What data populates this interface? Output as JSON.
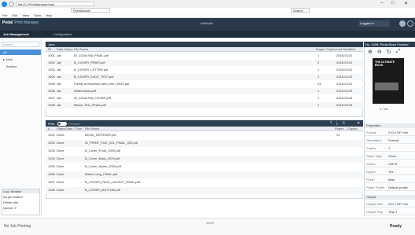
{
  "window": {
    "title": "Ready - FileManager",
    "min_glyph": "–",
    "max_glyph": "□",
    "close_glyph": "✕"
  },
  "browser": {
    "address": "file://C:/PrintManager/jobs",
    "tab_label": "FileManager",
    "menu_items": [
      "File",
      "Edit",
      "View",
      "Tools",
      "Help"
    ],
    "right_field": "Search"
  },
  "app": {
    "brand_a": "Pedal",
    "brand_b": "Print Manager",
    "center_label": "Hotfolder",
    "user_label": "Logged in",
    "nav_tabs": [
      "Job Management",
      "Configuration"
    ]
  },
  "sidebar": {
    "search_placeholder": "Search",
    "items": [
      {
        "label": "All",
        "selected": true
      },
      {
        "label": "Jobs"
      },
      {
        "label": "Archive"
      }
    ],
    "bottom_title": "Log / Monitor",
    "bottom_lines": [
      "No job loaded",
      "Printer idle",
      "Queue: 0"
    ]
  },
  "upper_panel": {
    "title": "Jobs",
    "columns": [
      "ID",
      "Date",
      "Name",
      "File Name",
      "Pages",
      "Copies",
      "Last Modified"
    ],
    "rows": [
      {
        "id": "1001",
        "date": "Jan",
        "file": "ID_1024x768_FINAL.pdf",
        "pages": "1",
        "mod": "2018-03-01"
      },
      {
        "id": "1002",
        "date": "Jan",
        "file": "B_COVER_PRINT.pdf",
        "pages": "2",
        "mod": "2018-03-01"
      },
      {
        "id": "1003",
        "date": "Jan",
        "file": "B_COVER_LETTER.pdf",
        "pages": "1",
        "mod": "2018-03-02"
      },
      {
        "id": "1004",
        "date": "Jan",
        "file": "B_COVER_FACE_TEXT.pdf",
        "pages": "1",
        "mod": "2018-03-02"
      },
      {
        "id": "1005",
        "date": "Jan",
        "file": "Family at Mountain lake print_r2020.pdf",
        "pages": "24",
        "mod": "2018-03-03"
      },
      {
        "id": "1006",
        "date": "Jan",
        "file": "Wales Book.pdf",
        "pages": "1",
        "mod": "2018-03-03"
      },
      {
        "id": "1007",
        "date": "Jan",
        "file": "ID_1024x768_COVER.pdf",
        "pages": "1",
        "mod": "2018-03-04"
      },
      {
        "id": "1008",
        "date": "Jan",
        "file": "Blanco Test_FINAL.pdf",
        "pages": "1",
        "mod": "2018-03-04"
      }
    ]
  },
  "lower_panel": {
    "title": "Print",
    "toggle_label": "Preview",
    "columns": [
      "#",
      "Status",
      "Date / Time",
      "File Name",
      "Pages",
      "Copies"
    ],
    "rows": [
      {
        "id": "1201",
        "stat": "Done",
        "file": "BOOK_INTERIOR.pdf",
        "pages": "24"
      },
      {
        "id": "1202",
        "stat": "Done",
        "file": "ID_PRINT_FILE_001_FINAL_002.pdf",
        "pages": ""
      },
      {
        "id": "1203",
        "stat": "Done",
        "file": "B_Cover_Front_2020.pdf",
        "pages": ""
      },
      {
        "id": "1204",
        "stat": "Done",
        "file": "B_Cover_Back_2020.pdf",
        "pages": ""
      },
      {
        "id": "1205",
        "stat": "Done",
        "file": "B_Cover_Spine_2020.pdf",
        "pages": ""
      },
      {
        "id": "1206",
        "stat": "Done",
        "file": "Wales Long_FINAL.pdf",
        "pages": ""
      },
      {
        "id": "1207",
        "stat": "Done",
        "file": "B_COVER_FACE_LAYOUT_FINAL.pdf",
        "pages": ""
      },
      {
        "id": "1208",
        "stat": "Done",
        "file": "B_COVER_BOTTOM.pdf",
        "pages": ""
      }
    ]
  },
  "preview": {
    "title": "No. 1008: Photo Book Preview",
    "book_title": "THE ULTIMATE BOOK",
    "page_label": "1 / 24",
    "props_title": "Properties",
    "props": [
      {
        "k": "Format",
        "v": "210 x 297 mm"
      },
      {
        "k": "Orientation",
        "v": "Portrait"
      },
      {
        "k": "Copies",
        "v": "1"
      },
      {
        "k": "Paper Type",
        "v": "Gloss"
      },
      {
        "k": "Colour",
        "v": "CMYK"
      },
      {
        "k": "Duplex",
        "v": "Yes"
      },
      {
        "k": "Finish",
        "v": "Matt"
      },
      {
        "k": "Paper Profile",
        "v": "Default profile"
      }
    ],
    "props2_title": "Output",
    "props2": [
      {
        "k": "Output Size",
        "v": "210 x 297 mm"
      },
      {
        "k": "Output Tray",
        "v": "Tray 1"
      }
    ]
  },
  "status": {
    "left": "No Job Printing",
    "mid": "100%",
    "ready": "Ready"
  },
  "colors": {
    "accent": "#2b7bbf",
    "header": "#2c3e50",
    "selected": "#4a90d9"
  }
}
